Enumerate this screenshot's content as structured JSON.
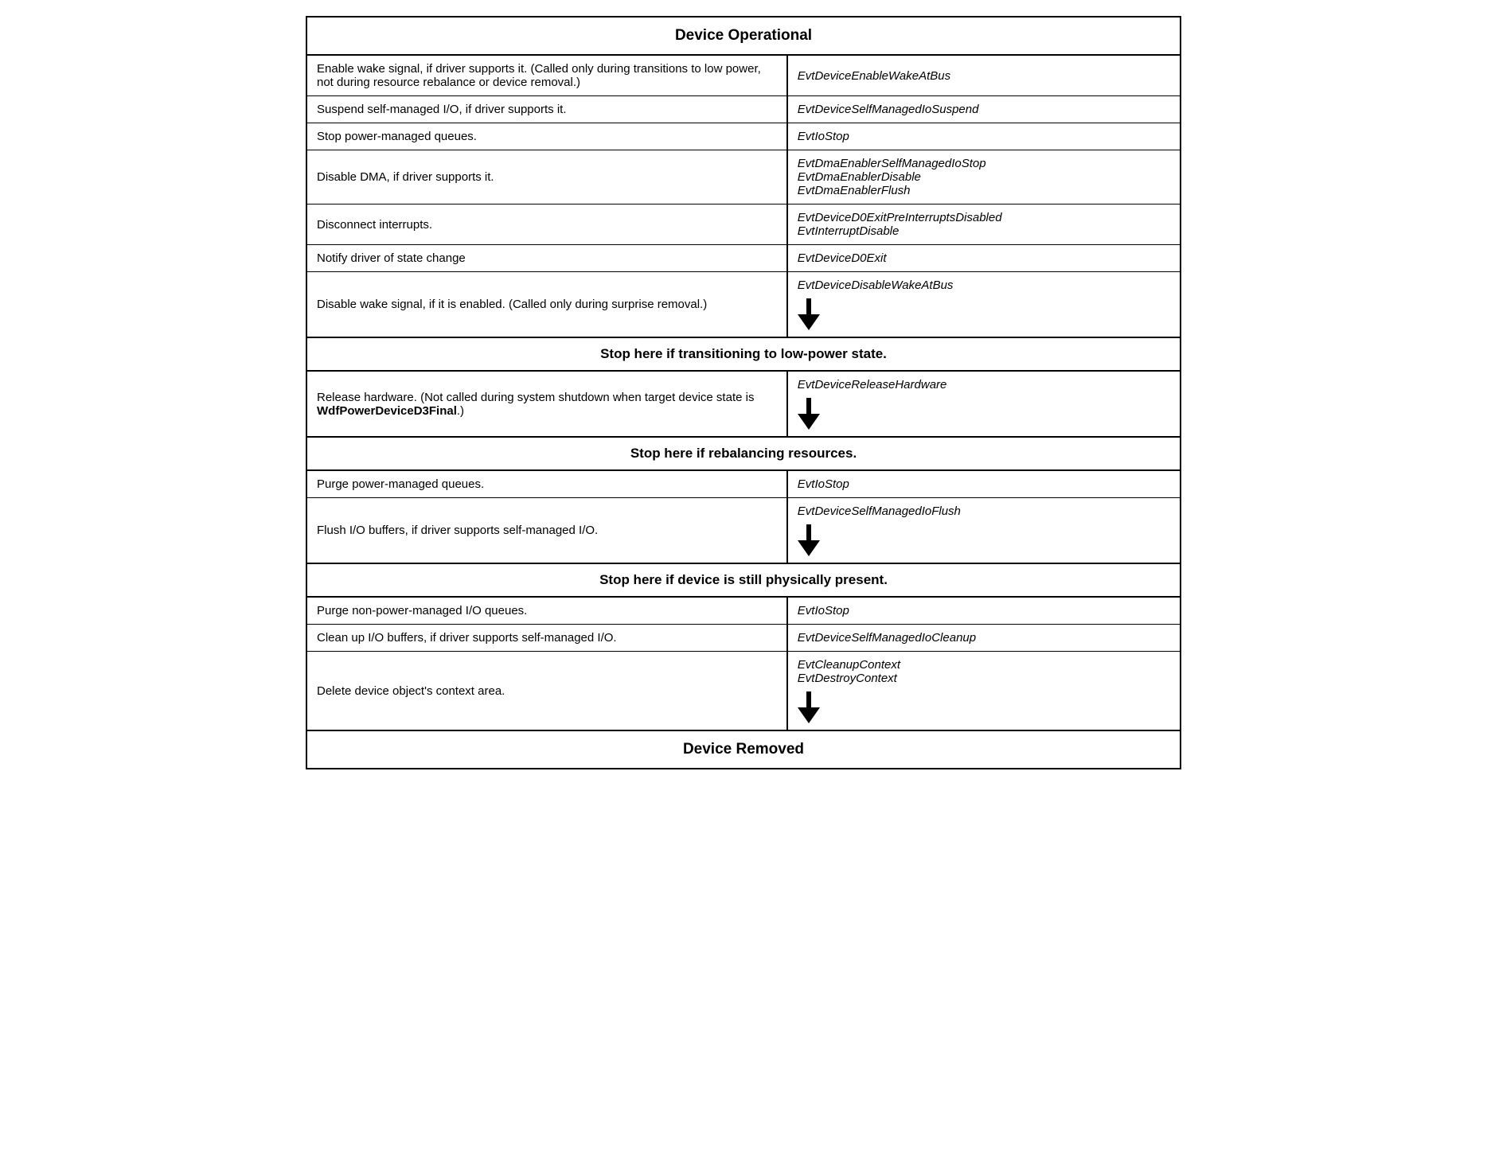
{
  "title": "Device Operational",
  "footer": "Device Removed",
  "rows_section1": [
    {
      "left": "Enable wake signal, if driver supports it. (Called only during transitions to low power, not during resource rebalance or device removal.)",
      "right": "EvtDeviceEnableWakeAtBus"
    },
    {
      "left": "Suspend self-managed I/O, if driver supports it.",
      "right": "EvtDeviceSelfManagedIoSuspend"
    },
    {
      "left": "Stop power-managed queues.",
      "right": "EvtIoStop"
    },
    {
      "left": "Disable DMA, if driver supports it.",
      "right_multi": [
        "EvtDmaEnablerSelfManagedIoStop",
        "EvtDmaEnablerDisable",
        "EvtDmaEnablerFlush"
      ]
    },
    {
      "left": "Disconnect interrupts.",
      "right_multi": [
        "EvtDeviceD0ExitPreInterruptsDisabled",
        "EvtInterruptDisable"
      ]
    },
    {
      "left": "Notify driver of state change",
      "right": "EvtDeviceD0Exit"
    },
    {
      "left": "Disable wake signal, if it is enabled. (Called only during surprise removal.)",
      "right": "EvtDeviceDisableWakeAtBus"
    }
  ],
  "stop1": "Stop here if transitioning to low-power state.",
  "rows_section2": [
    {
      "left": "Release hardware. (Not called during system shutdown when target device state is WdfPowerDeviceD3Final.)",
      "left_bold": "WdfPowerDeviceD3Final",
      "right": "EvtDeviceReleaseHardware"
    }
  ],
  "stop2": "Stop here if rebalancing resources.",
  "rows_section3": [
    {
      "left": "Purge power-managed queues.",
      "right": "EvtIoStop"
    },
    {
      "left": "Flush I/O buffers, if driver supports self-managed I/O.",
      "right": "EvtDeviceSelfManagedIoFlush"
    }
  ],
  "stop3": "Stop here if device is still physically present.",
  "rows_section4": [
    {
      "left": "Purge non-power-managed I/O queues.",
      "right": "EvtIoStop"
    },
    {
      "left": "Clean up I/O buffers, if driver supports self-managed I/O.",
      "right": "EvtDeviceSelfManagedIoCleanup"
    },
    {
      "left": "Delete device object's context area.",
      "right_multi": [
        "EvtCleanupContext",
        "EvtDestroyContext"
      ]
    }
  ]
}
